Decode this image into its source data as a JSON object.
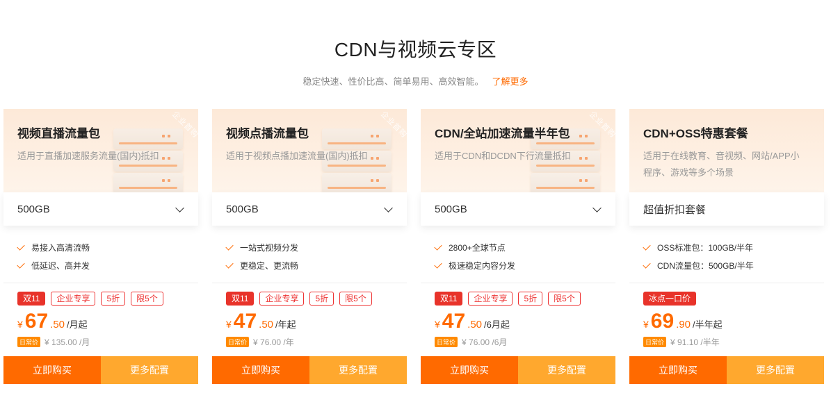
{
  "section": {
    "title": "CDN与视频云专区",
    "subtitle": "稳定快速、性价比高、简单易用、高效智能。",
    "more_link": "了解更多"
  },
  "ribbon_text": "企业首购",
  "colors": {
    "accent": "#ff6a00",
    "accent_light": "#ffa82e",
    "badge_red": "#e8332a"
  },
  "cards": [
    {
      "title": "视频直播流量包",
      "desc": "适用于直播加速服务流量(国内)抵扣",
      "select": "500GB",
      "features": [
        "易接入高清流畅",
        "低延迟、高并发"
      ],
      "badges": [
        "双11",
        "企业专享",
        "5折",
        "限5个"
      ],
      "price": {
        "currency": "¥",
        "int": "67",
        "dec": ".50",
        "unit": "/月起"
      },
      "daily_tag": "日常价",
      "daily_price": "¥ 135.00 /月",
      "buy": "立即购买",
      "config": "更多配置"
    },
    {
      "title": "视频点播流量包",
      "desc": "适用于视频点播加速流量(国内)抵扣",
      "select": "500GB",
      "features": [
        "一站式视频分发",
        "更稳定、更流畅"
      ],
      "badges": [
        "双11",
        "企业专享",
        "5折",
        "限5个"
      ],
      "price": {
        "currency": "¥",
        "int": "47",
        "dec": ".50",
        "unit": "/年起"
      },
      "daily_tag": "日常价",
      "daily_price": "¥ 76.00 /年",
      "buy": "立即购买",
      "config": "更多配置"
    },
    {
      "title": "CDN/全站加速流量半年包",
      "desc": "适用于CDN和DCDN下行流量抵扣",
      "select": "500GB",
      "features": [
        "2800+全球节点",
        "极速稳定内容分发"
      ],
      "badges": [
        "双11",
        "企业专享",
        "5折",
        "限5个"
      ],
      "price": {
        "currency": "¥",
        "int": "47",
        "dec": ".50",
        "unit": "/6月起"
      },
      "daily_tag": "日常价",
      "daily_price": "¥ 76.00 /6月",
      "buy": "立即购买",
      "config": "更多配置"
    },
    {
      "title": "CDN+OSS特惠套餐",
      "desc": "适用于在线教育、音视频、网站/APP小程序、游戏等多个场景",
      "select": "超值折扣套餐",
      "features": [
        "OSS标准包：100GB/半年",
        "CDN流量包：500GB/半年"
      ],
      "badges": [
        "冰点一口价"
      ],
      "price": {
        "currency": "¥",
        "int": "69",
        "dec": ".90",
        "unit": "/半年起"
      },
      "daily_tag": "日常价",
      "daily_price": "¥ 91.10 /半年",
      "buy": "立即购买",
      "config": "更多配置"
    }
  ]
}
